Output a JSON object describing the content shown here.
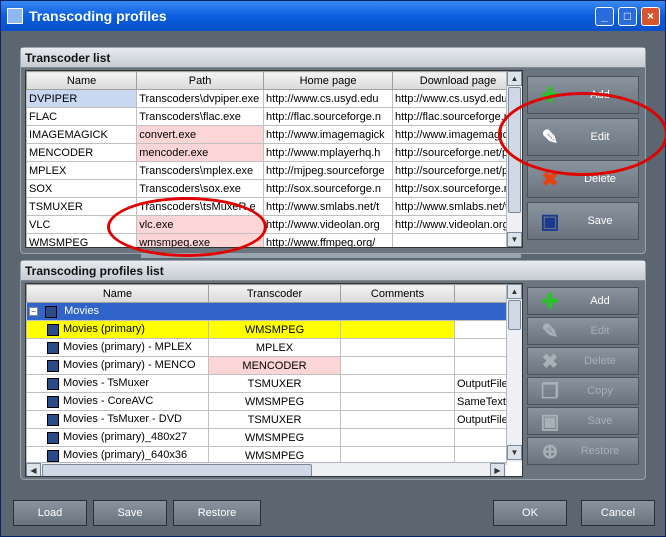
{
  "window": {
    "title": "Transcoding profiles"
  },
  "transcoder_list": {
    "title": "Transcoder list",
    "columns": [
      "Name",
      "Path",
      "Home page",
      "Download page"
    ],
    "rows": [
      [
        "DVPIPER",
        "Transcoders\\dvpiper.exe",
        "http://www.cs.usyd.edu",
        "http://www.cs.usyd.edu"
      ],
      [
        "FLAC",
        "Transcoders\\flac.exe",
        "http://flac.sourceforge.n",
        "http://flac.sourceforge.n"
      ],
      [
        "IMAGEMAGICK",
        "convert.exe",
        "http://www.imagemagick",
        "http://www.imagemagic"
      ],
      [
        "MENCODER",
        "mencoder.exe",
        "http://www.mplayerhq.h",
        "http://sourceforge.net/p"
      ],
      [
        "MPLEX",
        "Transcoders\\mplex.exe",
        "http://mjpeg.sourceforge",
        "http://sourceforge.net/p"
      ],
      [
        "SOX",
        "Transcoders\\sox.exe",
        "http://sox.sourceforge.n",
        "http://sox.sourceforge.n"
      ],
      [
        "TSMUXER",
        "Transcoders\\tsMuxeR.e",
        "http://www.smlabs.net/t",
        "http://www.smlabs.net/t"
      ],
      [
        "VLC",
        "vlc.exe",
        "http://www.videolan.org",
        "http://www.videolan.org"
      ],
      [
        "WMSMPEG",
        "wmsmpeg.exe",
        "http://www.ffmpeg.org/",
        ""
      ]
    ],
    "buttons": {
      "add": "Add",
      "edit": "Edit",
      "delete": "Delete",
      "save": "Save"
    }
  },
  "profiles_list": {
    "title": "Transcoding profiles list",
    "columns": [
      "Name",
      "Transcoder",
      "Comments",
      ""
    ],
    "group": "Movies",
    "rows": [
      [
        "Movies (primary)",
        "WMSMPEG",
        "",
        ""
      ],
      [
        "Movies (primary) - MPLEX",
        "MPLEX",
        "",
        ""
      ],
      [
        "Movies (primary) - MENCO",
        "MENCODER",
        "",
        ""
      ],
      [
        "Movies - TsMuxer",
        "TSMUXER",
        "",
        "OutputFile"
      ],
      [
        "Movies - CoreAVC",
        "WMSMPEG",
        "",
        "SameText"
      ],
      [
        "Movies - TsMuxer - DVD",
        "TSMUXER",
        "",
        "OutputFile"
      ],
      [
        "Movies (primary)_480x27",
        "WMSMPEG",
        "",
        ""
      ],
      [
        "Movies (primary)_640x36",
        "WMSMPEG",
        "",
        ""
      ]
    ],
    "buttons": {
      "add": "Add",
      "edit": "Edit",
      "delete": "Delete",
      "copy": "Copy",
      "save": "Save",
      "restore": "Restore"
    }
  },
  "bottom_buttons": {
    "load": "Load",
    "save": "Save",
    "restore": "Restore",
    "ok": "OK",
    "cancel": "Cancel"
  },
  "colors": {
    "highlight": "#ffff00",
    "pink": "#fcd6d6",
    "annotation": "#e00000"
  }
}
